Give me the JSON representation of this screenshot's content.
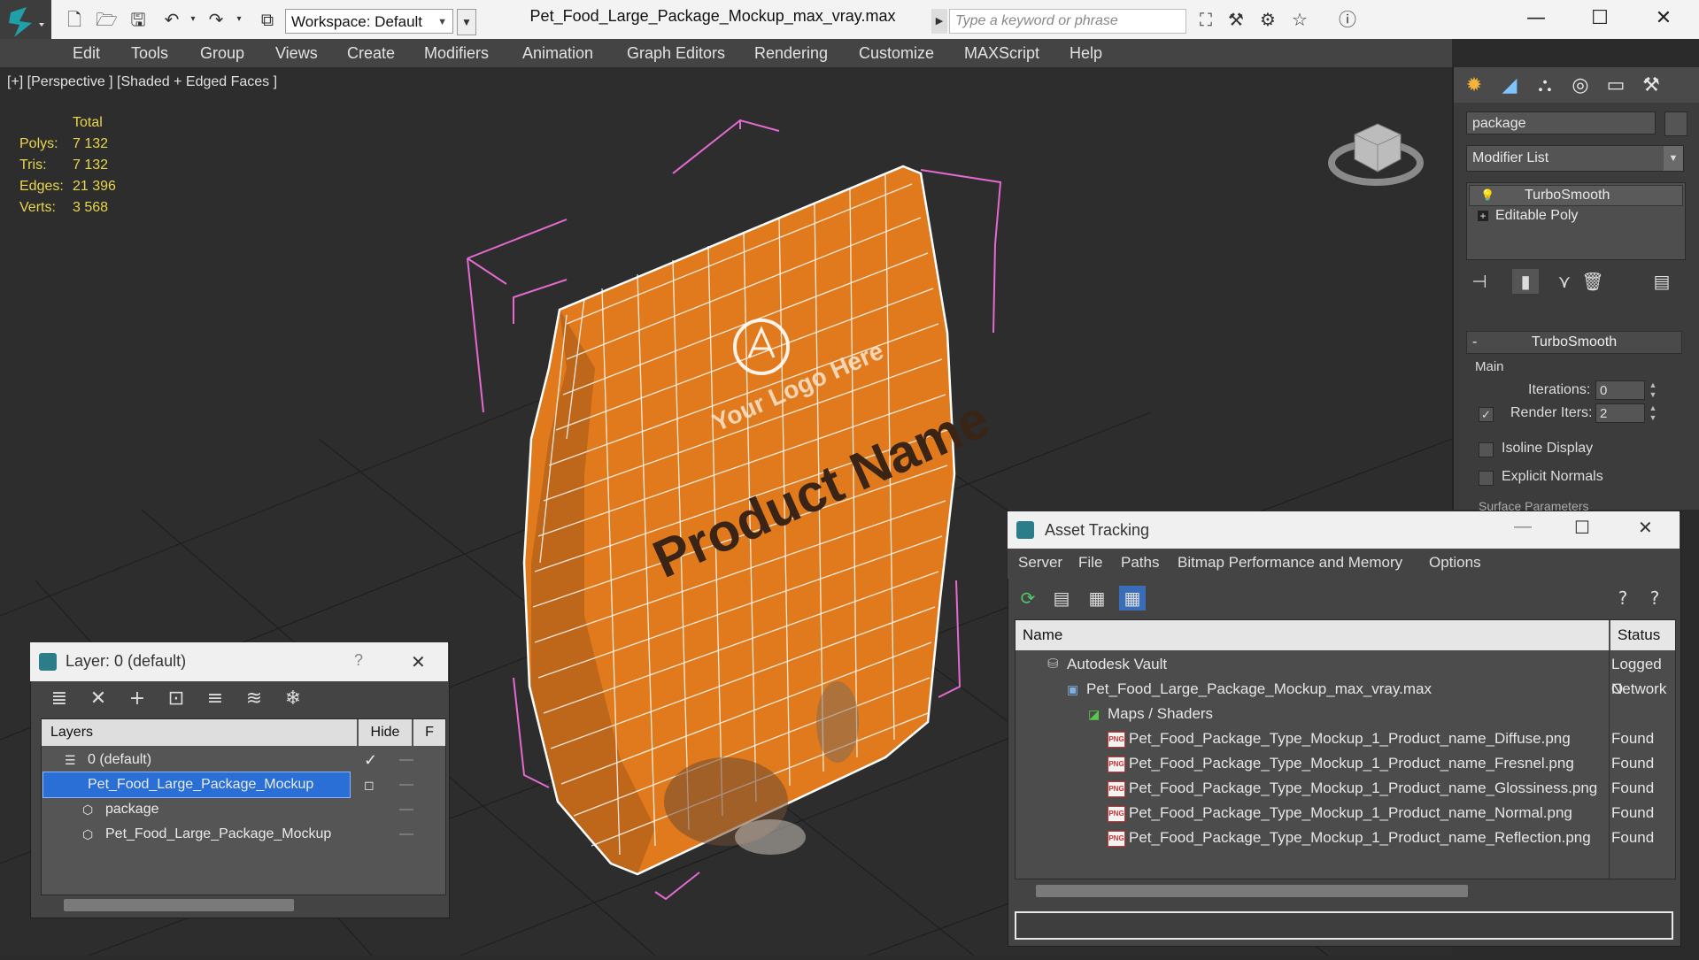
{
  "window": {
    "title": "Pet_Food_Large_Package_Mockup_max_vray.max",
    "workspace": "Workspace: Default",
    "search_placeholder": "Type a keyword or phrase",
    "controls": {
      "minimize": "—",
      "maximize": "☐",
      "close": "✕"
    }
  },
  "menu": [
    "Edit",
    "Tools",
    "Group",
    "Views",
    "Create",
    "Modifiers",
    "Animation",
    "Graph Editors",
    "Rendering",
    "Customize",
    "MAXScript",
    "Help"
  ],
  "viewport": {
    "label": "[+] [Perspective ] [Shaded + Edged Faces ]",
    "stats": {
      "header": "Total",
      "rows": [
        {
          "label": "Polys:",
          "value": "7 132"
        },
        {
          "label": "Tris:",
          "value": "7 132"
        },
        {
          "label": "Edges:",
          "value": "21 396"
        },
        {
          "label": "Verts:",
          "value": "3 568"
        }
      ]
    },
    "package_text": {
      "product": "Product Name",
      "logo": "Your Logo Here"
    }
  },
  "command_panel": {
    "object_name": "package",
    "modifier_list": "Modifier List",
    "stack": [
      "TurboSmooth",
      "Editable Poly"
    ],
    "rollout": {
      "title": "TurboSmooth",
      "minus": "-",
      "group": "Main",
      "iterations_label": "Iterations:",
      "iterations_value": "0",
      "render_iters_label": "Render Iters:",
      "render_iters_value": "2",
      "render_iters_checked": true,
      "isoline_label": "Isoline Display",
      "explicit_normals_label": "Explicit Normals",
      "surface_params_label": "Surface Parameters"
    }
  },
  "layer_dialog": {
    "title": "Layer: 0 (default)",
    "help": "?",
    "close": "✕",
    "columns": [
      "Layers",
      "Hide",
      "F"
    ],
    "rows": [
      {
        "name": "0 (default)",
        "indent": 0,
        "selected": false,
        "active": true
      },
      {
        "name": "Pet_Food_Large_Package_Mockup",
        "indent": 0,
        "selected": true,
        "active": false
      },
      {
        "name": "package",
        "indent": 1,
        "selected": false,
        "active": false
      },
      {
        "name": "Pet_Food_Large_Package_Mockup",
        "indent": 1,
        "selected": false,
        "active": false
      }
    ]
  },
  "asset_tracking": {
    "title": "Asset Tracking",
    "menu": [
      "Server",
      "File",
      "Paths",
      "Bitmap Performance and Memory",
      "Options"
    ],
    "columns": [
      "Name",
      "Status"
    ],
    "rows": [
      {
        "name": "Autodesk Vault",
        "status": "Logged O",
        "indent": 1,
        "icon": "vault"
      },
      {
        "name": "Pet_Food_Large_Package_Mockup_max_vray.max",
        "status": "Network",
        "indent": 2,
        "icon": "max"
      },
      {
        "name": "Maps / Shaders",
        "status": "",
        "indent": 3,
        "icon": "maps"
      },
      {
        "name": "Pet_Food_Package_Type_Mockup_1_Product_name_Diffuse.png",
        "status": "Found",
        "indent": 4,
        "icon": "png"
      },
      {
        "name": "Pet_Food_Package_Type_Mockup_1_Product_name_Fresnel.png",
        "status": "Found",
        "indent": 4,
        "icon": "png"
      },
      {
        "name": "Pet_Food_Package_Type_Mockup_1_Product_name_Glossiness.png",
        "status": "Found",
        "indent": 4,
        "icon": "png"
      },
      {
        "name": "Pet_Food_Package_Type_Mockup_1_Product_name_Normal.png",
        "status": "Found",
        "indent": 4,
        "icon": "png"
      },
      {
        "name": "Pet_Food_Package_Type_Mockup_1_Product_name_Reflection.png",
        "status": "Found",
        "indent": 4,
        "icon": "png"
      }
    ],
    "png_icon_text": "PNG"
  },
  "colors": {
    "package_orange": "#e07a1c",
    "wire": "#ffffff",
    "bbox": "#e36ad0",
    "stats_yellow": "#e8d64a",
    "selection_blue": "#2a6fd6"
  }
}
